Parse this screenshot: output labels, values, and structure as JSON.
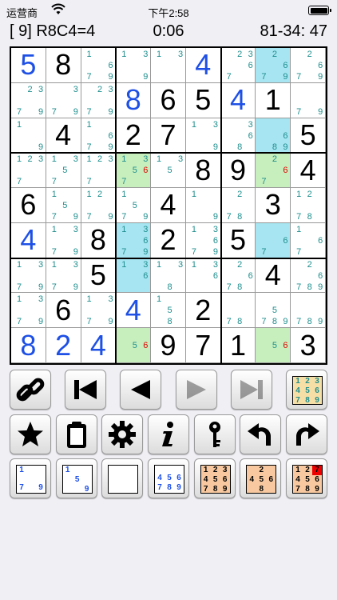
{
  "status_bar": {
    "carrier": "运营商",
    "time": "下午2:58"
  },
  "info_bar": {
    "move": "[ 9] R8C4=4",
    "timer": "0:06",
    "score": "81-34: 47"
  },
  "colors": {
    "given": "#000000",
    "user_entry": "#1e50e6",
    "candidate": "#1f8e8e",
    "candidate_conflict": "#e00000",
    "highlight_cyan": "#a6e5f1",
    "highlight_green": "#c7efbd"
  },
  "board": [
    [
      {
        "v": "5",
        "t": "u"
      },
      {
        "v": "8",
        "t": "g"
      },
      {
        "c": "1,6,7,9"
      },
      {
        "c": "1,3,9"
      },
      {
        "c": "1,3"
      },
      {
        "v": "4",
        "t": "u"
      },
      {
        "c": "2,3,6,7"
      },
      {
        "c": "2,6,7,9",
        "hl": "cyan"
      },
      {
        "c": "2,6,7,9"
      }
    ],
    [
      {
        "c": "2,3,7,9"
      },
      {
        "c": "3,7,9"
      },
      {
        "c": "2,3,7,9"
      },
      {
        "v": "8",
        "t": "u"
      },
      {
        "v": "6",
        "t": "g"
      },
      {
        "v": "5",
        "t": "g"
      },
      {
        "v": "4",
        "t": "u"
      },
      {
        "v": "1",
        "t": "g"
      },
      {
        "c": "7,9"
      }
    ],
    [
      {
        "c": "1,9"
      },
      {
        "v": "4",
        "t": "g"
      },
      {
        "c": "1,6,7,9"
      },
      {
        "v": "2",
        "t": "g"
      },
      {
        "v": "7",
        "t": "g"
      },
      {
        "c": "1,3,9"
      },
      {
        "c": "3,6,8"
      },
      {
        "c": "6,8,9",
        "hl": "cyan"
      },
      {
        "v": "5",
        "t": "g"
      }
    ],
    [
      {
        "c": "1,2,3,7"
      },
      {
        "c": "1,3,5,7"
      },
      {
        "c": "1,2,3,7"
      },
      {
        "c": "1,3,5,6,7",
        "hl": "green",
        "red": "6"
      },
      {
        "c": "1,3,5"
      },
      {
        "v": "8",
        "t": "g"
      },
      {
        "v": "9",
        "t": "g"
      },
      {
        "c": "2,6,7",
        "hl": "green",
        "red": "6"
      },
      {
        "v": "4",
        "t": "g"
      }
    ],
    [
      {
        "v": "6",
        "t": "g"
      },
      {
        "c": "1,5,7,9"
      },
      {
        "c": "1,2,7,9"
      },
      {
        "c": "1,5,7,9"
      },
      {
        "v": "4",
        "t": "g"
      },
      {
        "c": "1,9"
      },
      {
        "c": "2,7,8"
      },
      {
        "v": "3",
        "t": "g"
      },
      {
        "c": "1,2,7,8"
      }
    ],
    [
      {
        "v": "4",
        "t": "u"
      },
      {
        "c": "1,3,7,9"
      },
      {
        "v": "8",
        "t": "g"
      },
      {
        "c": "1,3,6,7,9",
        "hl": "cyan"
      },
      {
        "v": "2",
        "t": "g"
      },
      {
        "c": "1,3,6,7,9"
      },
      {
        "v": "5",
        "t": "g"
      },
      {
        "c": "6,7",
        "hl": "cyan"
      },
      {
        "c": "1,6,7"
      }
    ],
    [
      {
        "c": "1,3,7,9"
      },
      {
        "c": "1,3,7,9"
      },
      {
        "v": "5",
        "t": "g"
      },
      {
        "c": "1,3,6",
        "hl": "cyan"
      },
      {
        "c": "1,3,8"
      },
      {
        "c": "1,3,6"
      },
      {
        "c": "2,6,7,8"
      },
      {
        "v": "4",
        "t": "g"
      },
      {
        "c": "2,6,7,8,9"
      }
    ],
    [
      {
        "c": "1,3,7,9"
      },
      {
        "v": "6",
        "t": "g"
      },
      {
        "c": "1,3,7,9"
      },
      {
        "v": "4",
        "t": "u"
      },
      {
        "c": "1,5,8"
      },
      {
        "v": "2",
        "t": "g"
      },
      {
        "c": "7,8"
      },
      {
        "c": "5,7,8,9"
      },
      {
        "c": "7,8,9"
      }
    ],
    [
      {
        "v": "8",
        "t": "u"
      },
      {
        "v": "2",
        "t": "u"
      },
      {
        "v": "4",
        "t": "u"
      },
      {
        "c": "5,6",
        "hl": "green",
        "red": "6"
      },
      {
        "v": "9",
        "t": "g"
      },
      {
        "v": "7",
        "t": "g"
      },
      {
        "v": "1",
        "t": "g"
      },
      {
        "c": "5,6",
        "hl": "green",
        "red": "6"
      },
      {
        "v": "3",
        "t": "g"
      }
    ]
  ],
  "toolbar_rows": [
    [
      {
        "name": "link-button",
        "icon": "link-icon"
      },
      {
        "name": "first-move-button",
        "icon": "skip-back-icon"
      },
      {
        "name": "prev-move-button",
        "icon": "play-back-icon"
      },
      {
        "name": "next-move-button",
        "icon": "play-forward-icon",
        "disabled": true
      },
      {
        "name": "last-move-button",
        "icon": "skip-forward-icon",
        "disabled": true
      },
      {
        "name": "candidates-button",
        "icon": "candidate-grid-icon",
        "digits": [
          "1",
          "2",
          "3",
          "4",
          "5",
          "6",
          "7",
          "8",
          "9"
        ]
      }
    ],
    [
      {
        "name": "favorite-button",
        "icon": "star-icon"
      },
      {
        "name": "clipboard-button",
        "icon": "clipboard-icon"
      },
      {
        "name": "settings-button",
        "icon": "gear-icon"
      },
      {
        "name": "info-button",
        "icon": "info-icon"
      },
      {
        "name": "hint-button",
        "icon": "key-icon"
      },
      {
        "name": "undo-button",
        "icon": "undo-icon"
      },
      {
        "name": "redo-button",
        "icon": "redo-icon"
      }
    ],
    [
      {
        "name": "auto-candidates-button",
        "icon": "sparkle-grid-icon",
        "digits": [
          "1",
          "",
          "",
          "",
          "",
          "",
          "7",
          "",
          "9"
        ]
      },
      {
        "name": "edit-candidates-button",
        "icon": "pencil-grid-icon",
        "digits": [
          "1",
          "",
          "",
          "",
          "5",
          "",
          "",
          "",
          "9"
        ]
      },
      {
        "name": "pencil-mode-button",
        "icon": "pencil-icon",
        "digits": [
          "",
          "",
          "",
          "",
          "",
          "",
          "",
          "",
          ""
        ]
      },
      {
        "name": "fill-all-candidates-button",
        "icon": "sparkle-grid-icon",
        "digits": [
          "",
          "",
          "",
          "4",
          "5",
          "6",
          "7",
          "8",
          "9"
        ]
      },
      {
        "name": "candidate-overlay-button",
        "icon": "overlay-grid-icon",
        "digits": [
          "1",
          "2",
          "3",
          "4",
          "5",
          "6",
          "7",
          "8",
          "9"
        ]
      },
      {
        "name": "digit-picker-button",
        "icon": "digit-grid-icon",
        "digits": [
          "",
          "2",
          "",
          "4",
          "5",
          "6",
          "",
          "8",
          ""
        ]
      },
      {
        "name": "digit-picker-full-button",
        "icon": "digit-grid-icon",
        "digits": [
          "1",
          "2",
          "7",
          "4",
          "5",
          "6",
          "7",
          "8",
          "9"
        ]
      }
    ]
  ]
}
